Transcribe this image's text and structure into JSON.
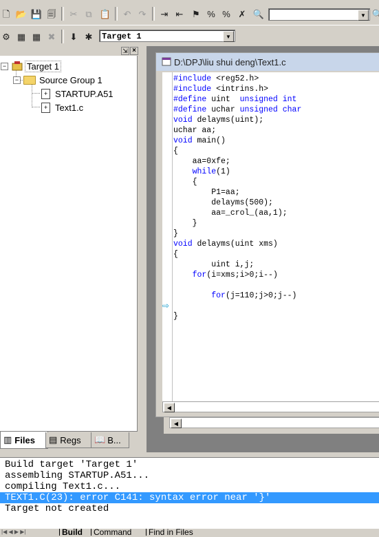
{
  "toolbar": {
    "target_combo": "Target 1",
    "find_combo": ""
  },
  "project": {
    "target": "Target 1",
    "group": "Source Group 1",
    "files": [
      "STARTUP.A51",
      "Text1.c"
    ],
    "tabs": [
      "Files",
      "Regs",
      "B..."
    ]
  },
  "editor": {
    "title": "D:\\DPJ\\liu shui deng\\Text1.c",
    "lines": [
      "#include <reg52.h>",
      "#include <intrins.h>",
      "#define uint  unsigned int",
      "#define uchar unsigned char",
      "void delayms(uint);",
      "uchar aa;",
      "void main()",
      "{",
      "    aa=0xfe;",
      "    while(1)",
      "    {",
      "        P1=aa;",
      "        delayms(500);",
      "        aa=_crol_(aa,1);",
      "    }",
      "}",
      "void delayms(uint xms)",
      "{",
      "        uint i,j;",
      "    for(i=xms;i>0;i--)",
      "",
      "        for(j=110;j>0;j--)",
      "",
      "}"
    ],
    "keywords": [
      "#include",
      "#define",
      "unsigned",
      "int",
      "char",
      "void",
      "while",
      "for"
    ],
    "arrow_line": 23
  },
  "output": {
    "lines": [
      "Build target 'Target 1'",
      "assembling STARTUP.A51...",
      "compiling Text1.c...",
      "TEXT1.C(23): error C141: syntax error near '}'",
      "Target not created"
    ],
    "highlight_index": 3,
    "tabs": [
      "Build",
      "Command",
      "Find in Files"
    ]
  },
  "colors": {
    "keyword": "#0000ff",
    "selection": "#3399ff",
    "title_bar": "#c8d6ea"
  }
}
